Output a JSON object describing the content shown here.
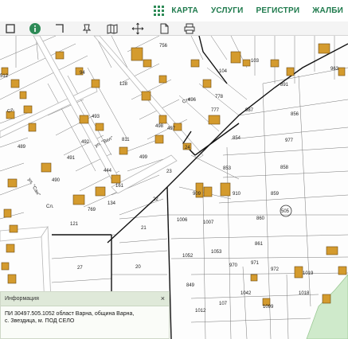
{
  "nav": {
    "items": [
      "КАРТА",
      "УСЛУГИ",
      "РЕГИСТРИ",
      "ЖАЛБИ"
    ],
    "accent_color": "#1e7a4c"
  },
  "toolbar": {
    "tools": [
      "select-icon",
      "info-icon",
      "measure-angle-icon",
      "pin-icon",
      "book-map-icon",
      "crosshair-icon",
      "document-icon",
      "print-icon"
    ]
  },
  "map": {
    "parcel_labels": {
      "p756": "756",
      "p103": "103",
      "p963": "963",
      "p512": "512",
      "p94": "94",
      "p104": "104",
      "p891": "891",
      "p128": "128",
      "p496": "496",
      "p778": "778",
      "p777": "777",
      "p987": "987",
      "p856": "856",
      "p493": "493",
      "p498": "498",
      "p811": "811",
      "p497": "497",
      "p854": "854",
      "p977": "977",
      "p489": "489",
      "p492": "492",
      "p24": "24",
      "p490": "490",
      "p491": "491",
      "p499": "499",
      "p444": "444",
      "p853": "853",
      "p858": "858",
      "p23": "23",
      "p161": "161",
      "p909": "909",
      "p910": "910",
      "p859": "859",
      "p22": "22",
      "p134": "134",
      "p769": "769",
      "p1006": "1006",
      "p860": "860",
      "p505": "505",
      "p1007": "1007",
      "p121": "121",
      "p21": "21",
      "p1052": "1052",
      "p1053": "1053",
      "p861": "861",
      "p27": "27",
      "p20": "20",
      "p970": "970",
      "p971": "971",
      "p972": "972",
      "p1019": "1019",
      "p849": "849",
      "p1018": "1018",
      "p1042": "1042",
      "p1099": "1099",
      "p107": "107",
      "p1012": "1012"
    },
    "street_labels": {
      "s1": "Сл.",
      "s2": "ул. \"Вел\"",
      "s3": "ул. \"Сан\"",
      "s4": "Сте",
      "s5": "Сл."
    }
  },
  "info_panel": {
    "title": "Информация",
    "close": "×",
    "line1": "ПИ 30497.505.1052 област Варна, община Варна,",
    "line2": "с. Звездица, м. ПОД СЕЛО"
  }
}
